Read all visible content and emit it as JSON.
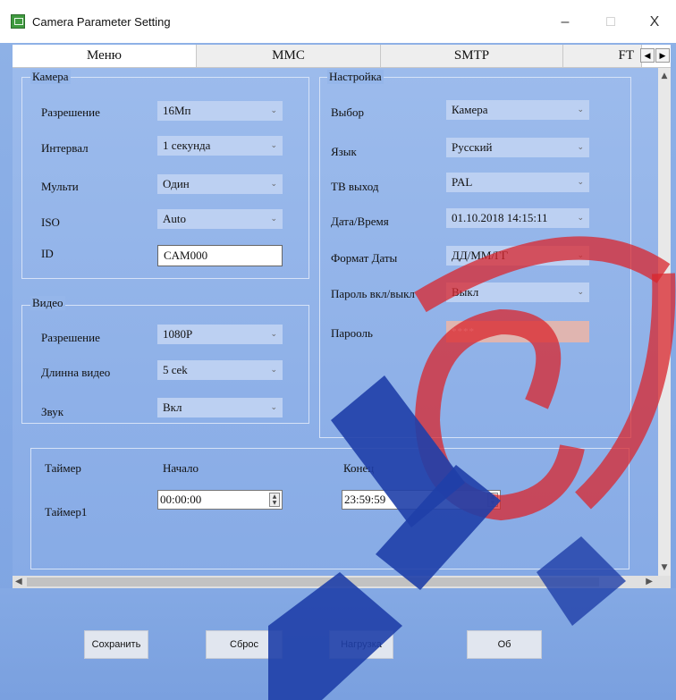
{
  "window": {
    "title": "Camera Parameter Setting",
    "controls": {
      "minimize": "–",
      "maximize": "□",
      "close": "X"
    }
  },
  "tabs": [
    {
      "label": "Меню",
      "active": true
    },
    {
      "label": "MMC",
      "active": false
    },
    {
      "label": "SMTP",
      "active": false
    },
    {
      "label": "FT",
      "active": false
    }
  ],
  "camera": {
    "group_label": "Камера",
    "resolution": {
      "label": "Разрешение",
      "value": "16Мп"
    },
    "interval": {
      "label": "Интервал",
      "value": "1 секунда"
    },
    "multi": {
      "label": "Мульти",
      "value": "Один"
    },
    "iso": {
      "label": "ISO",
      "value": "Auto"
    },
    "id": {
      "label": "ID",
      "value": "CAM000"
    }
  },
  "video": {
    "group_label": "Видео",
    "resolution": {
      "label": "Разрешение",
      "value": "1080P"
    },
    "length": {
      "label": "Длинна видео",
      "value": "5 cek"
    },
    "sound": {
      "label": "Звук",
      "value": "Вкл"
    }
  },
  "settings": {
    "group_label": "Настройка",
    "mode": {
      "label": "Выбор",
      "value": "Камера"
    },
    "language": {
      "label": "Язык",
      "value": "Русский"
    },
    "tv_out": {
      "label": "ТВ выход",
      "value": "PAL"
    },
    "datetime": {
      "label": "Дата/Время",
      "value": "01.10.2018 14:15:11"
    },
    "date_format": {
      "label": "Формат Даты",
      "value": "ДД/ММ/ГГ"
    },
    "password_toggle": {
      "label": "Пароль вкл/выкл",
      "value": "Выкл"
    },
    "password": {
      "label": "Парооль",
      "value": "****"
    }
  },
  "timer": {
    "header": "Таймер",
    "start_header": "Начало",
    "end_header": "Конец",
    "row_label": "Таймер1",
    "start_value": "00:00:00",
    "end_value": "23:59:59"
  },
  "buttons": {
    "save": "Сохранить",
    "reset": "Сброс",
    "load": "Нагрузка",
    "about": "Об"
  },
  "colors": {
    "window_bg": "#86abe6",
    "combo_bg": "#bcd0f2",
    "password_bg": "#e0b5b0",
    "watermark_blue": "#1f3fa8",
    "watermark_red": "#d9262c"
  }
}
